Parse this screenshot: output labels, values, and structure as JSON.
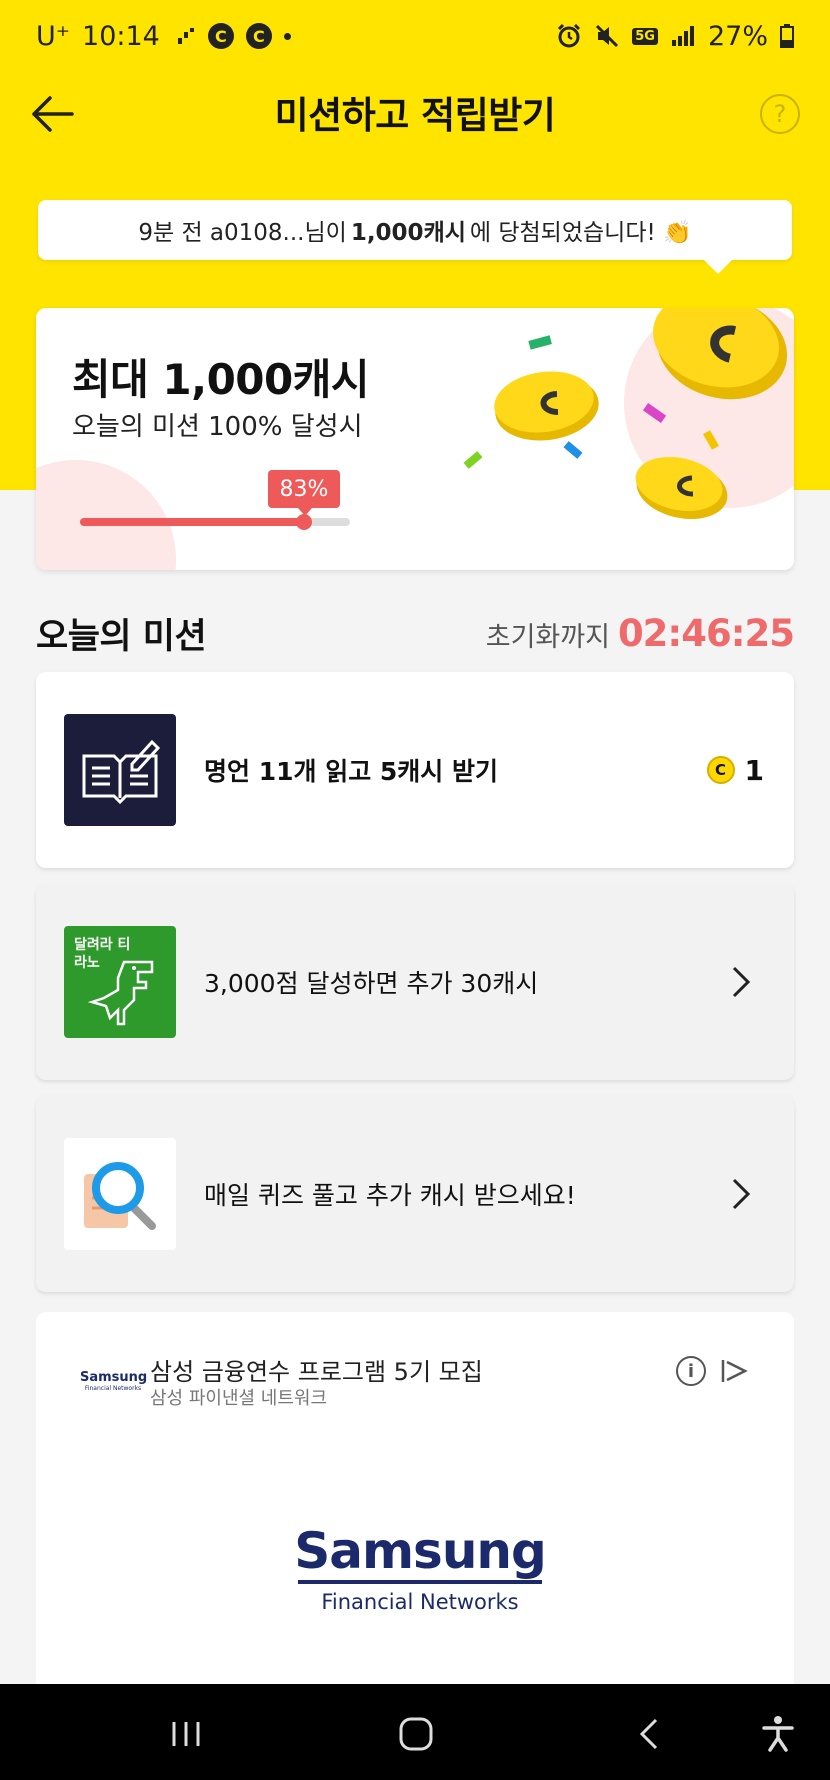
{
  "status_bar": {
    "carrier": "U⁺",
    "time": "10:14",
    "notif_icon_1": "C",
    "notif_icon_2": "C",
    "network": "5G",
    "battery": "27%"
  },
  "header": {
    "title": "미션하고 적립받기"
  },
  "winner_banner": {
    "prefix": "9분 전 a0108...님이",
    "amount": "1,000캐시",
    "suffix": "에 당첨되었습니다! 👏"
  },
  "reward_card": {
    "title": "최대 1,000캐시",
    "subtitle": "오늘의 미션 100% 달성시",
    "progress_label": "83%",
    "progress_value": 0.83
  },
  "section": {
    "title": "오늘의 미션",
    "reset_label": "초기화까지",
    "reset_time": "02:46:25"
  },
  "missions": [
    {
      "label": "명언 11개 읽고 5캐시 받기",
      "reward_icon": "C",
      "reward": "1"
    },
    {
      "label": "3,000점 달성하면 추가 30캐시",
      "thumb_text": "달려라 티라노"
    },
    {
      "label": "매일 퀴즈 풀고 추가 캐시 받으세요!"
    }
  ],
  "ad": {
    "logo_text": "Samsung",
    "logo_sub": "Financial Networks",
    "title": "삼성 금융연수 프로그램 5기 모집",
    "subtitle": "삼성 파이낸셜 네트워크",
    "info_label": "i",
    "brand_name": "Samsung",
    "brand_tagline": "Financial Networks"
  },
  "colors": {
    "brand_yellow": "#ffe400",
    "accent_red": "#ee5a5a",
    "samsung_navy": "#1c2a6b"
  }
}
